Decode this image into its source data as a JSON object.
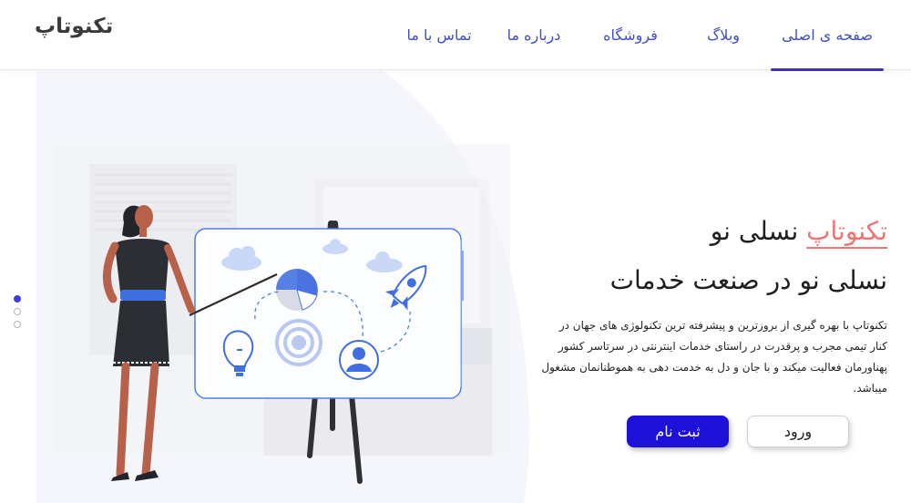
{
  "header": {
    "logo": "تکنوتاپ",
    "nav": [
      {
        "label": "صفحه ی اصلی",
        "active": true
      },
      {
        "label": "وبلاگ"
      },
      {
        "label": "فروشگاه"
      },
      {
        "label": "درباره ما"
      },
      {
        "label": "تماس با ما"
      }
    ]
  },
  "hero": {
    "headline_brand": "تکنوتاپ",
    "headline_rest": " نسلی نو",
    "subheadline": "نسلی نو در صنعت خدمات",
    "description": "تکنوتاپ با بهره گیری از بروزترین و پیشرفته ترین تکنولوژی های  جهان در کنار تیمی مجرب و پرقدرت در  راستای خدمات اینترنتی در سرتاسر کشور پهناورمان فعالیت میکند و با جان و دل به خدمت دهی به هموطنانمان مشغول میباشد.",
    "login_label": "ورود",
    "register_label": "ثبت نام"
  },
  "slider": {
    "count": 3,
    "active_index": 0
  },
  "colors": {
    "nav_text": "#3f4fc4",
    "nav_underline": "#3c2fc9",
    "brand_accent": "#f07470",
    "primary_button": "#1d10d8",
    "illustration_blue": "#3f6fe0"
  },
  "icons": [
    "cloud-icon",
    "pie-chart-icon",
    "rocket-icon",
    "lightbulb-icon",
    "target-icon",
    "user-avatar-icon"
  ]
}
